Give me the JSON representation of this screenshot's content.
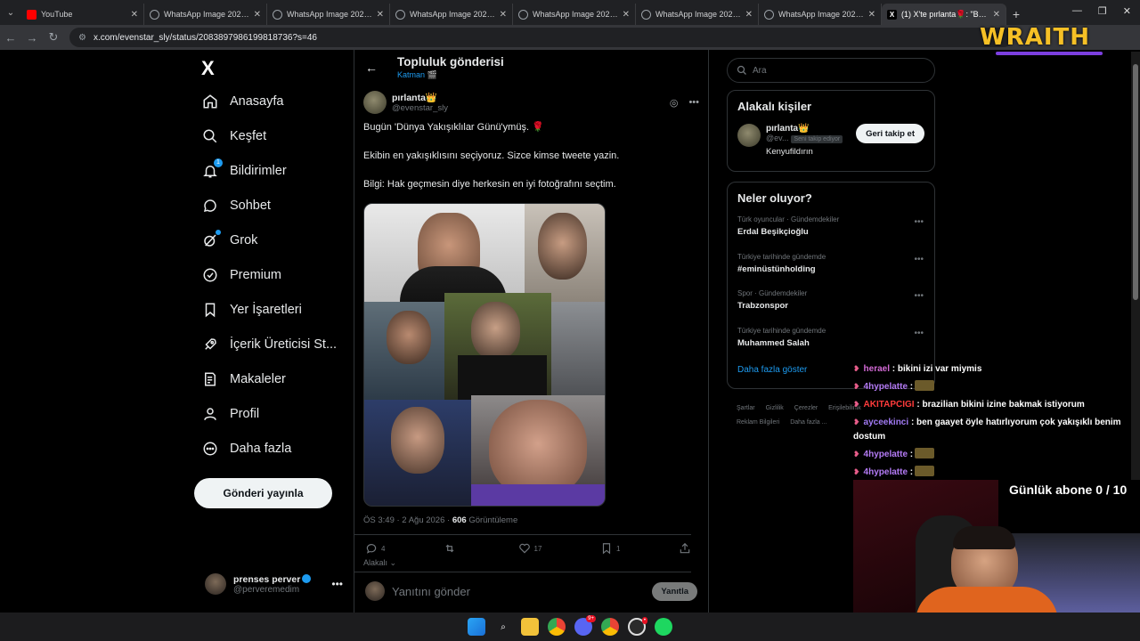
{
  "browser": {
    "tabs": [
      {
        "title": "YouTube",
        "icon": "youtube-icon"
      },
      {
        "title": "WhatsApp Image 2026-0",
        "icon": "whatsapp-icon"
      },
      {
        "title": "WhatsApp Image 2026-0",
        "icon": "whatsapp-icon"
      },
      {
        "title": "WhatsApp Image 2026-0",
        "icon": "whatsapp-icon"
      },
      {
        "title": "WhatsApp Image 2026-0",
        "icon": "whatsapp-icon"
      },
      {
        "title": "WhatsApp Image 2026-0",
        "icon": "whatsapp-icon"
      },
      {
        "title": "WhatsApp Image 2026-0",
        "icon": "whatsapp-icon"
      },
      {
        "title": "(1) X'te pırlanta🌹: \"Bugü",
        "icon": "x-icon",
        "active": true
      }
    ],
    "url": "x.com/evenstar_sly/status/2083897986199818736?s=46"
  },
  "overlay": {
    "brand": "WRAITH",
    "subs_goal": "Günlük abone 0 / 10"
  },
  "nav": {
    "logo": "X",
    "items": [
      {
        "label": "Anasayfa",
        "icon": "home-icon"
      },
      {
        "label": "Keşfet",
        "icon": "search-icon"
      },
      {
        "label": "Bildirimler",
        "icon": "bell-icon",
        "badge": "1"
      },
      {
        "label": "Sohbet",
        "icon": "chat-icon"
      },
      {
        "label": "Grok",
        "icon": "grok-icon"
      },
      {
        "label": "Premium",
        "icon": "premium-icon"
      },
      {
        "label": "Yer İşaretleri",
        "icon": "bookmark-icon"
      },
      {
        "label": "İçerik Üreticisi St...",
        "icon": "rocket-icon"
      },
      {
        "label": "Makaleler",
        "icon": "article-icon"
      },
      {
        "label": "Profil",
        "icon": "profile-icon"
      },
      {
        "label": "Daha fazla",
        "icon": "more-circle-icon"
      }
    ],
    "post_button": "Gönderi yayınla",
    "account": {
      "name": "prenses perver",
      "handle": "@perveremedim"
    }
  },
  "post": {
    "header_title": "Topluluk gönderisi",
    "header_sub": "Katman 🎬",
    "author_name": "pırlanta👑",
    "author_handle": "@evenstar_sly",
    "lines": [
      "Bugün 'Dünya Yakışıklılar Günü'ymüş. 🌹",
      "Ekibin en yakışıklısını seçiyoruz. Sizce kimse tweete yazin.",
      "Bilgi: Hak geçmesin diye herkesin en iyi fotoğrafını seçtim."
    ],
    "time": "ÖS 3:49 · 2 Ağu 2026 · ",
    "views": "606",
    "views_label": " Görüntüleme",
    "replies": "4",
    "reposts": "",
    "likes": "17",
    "bookmarks": "1",
    "relevance": "Alakalı ⌄",
    "reply_placeholder": "Yanıtını gönder",
    "reply_button": "Yanıtla"
  },
  "right": {
    "search_placeholder": "Ara",
    "related_title": "Alakalı kişiler",
    "person": {
      "name": "pırlanta👑",
      "handle": "@ev...",
      "follows_you": "Seni takip ediyor",
      "bio": "Kenyufildırın",
      "button": "Geri takip et"
    },
    "trends_title": "Neler oluyor?",
    "trends": [
      {
        "category": "Türk oyuncular · Gündemdekiler",
        "name": "Erdal Beşikçioğlu"
      },
      {
        "category": "Türkiye tarihinde gündemde",
        "name": "#eminüstünholding"
      },
      {
        "category": "Spor · Gündemdekiler",
        "name": "Trabzonspor"
      },
      {
        "category": "Türkiye tarihinde gündemde",
        "name": "Muhammed Salah"
      }
    ],
    "show_more": "Daha fazla göster",
    "footer": [
      "Şartlar",
      "Gizlilik",
      "Çerezler",
      "Erişilebilirlik",
      "Reklam Bilgileri",
      "Daha fazla ..."
    ]
  },
  "chat": [
    {
      "user": "herael",
      "text": ": bikini izi var miymis",
      "cls": "u1"
    },
    {
      "user": "4hypelatte",
      "text": ":",
      "cls": "u2",
      "emote": true
    },
    {
      "user": "AKITAPCIGI",
      "text": ": brazilian bikini izine bakmak istiyorum",
      "cls": "u3"
    },
    {
      "user": "ayceekinci",
      "text": ": ben gaayet öyle hatırlıyorum çok yakışıklı benim dostum",
      "cls": "u4"
    },
    {
      "user": "4hypelatte",
      "text": ":",
      "cls": "u2",
      "emote": true
    },
    {
      "user": "4hypelatte",
      "text": ":",
      "cls": "u2",
      "emote": true
    }
  ],
  "colors": {
    "accent": "#1d9bf0",
    "background": "#000000",
    "brand_gold": "#f6c026"
  }
}
